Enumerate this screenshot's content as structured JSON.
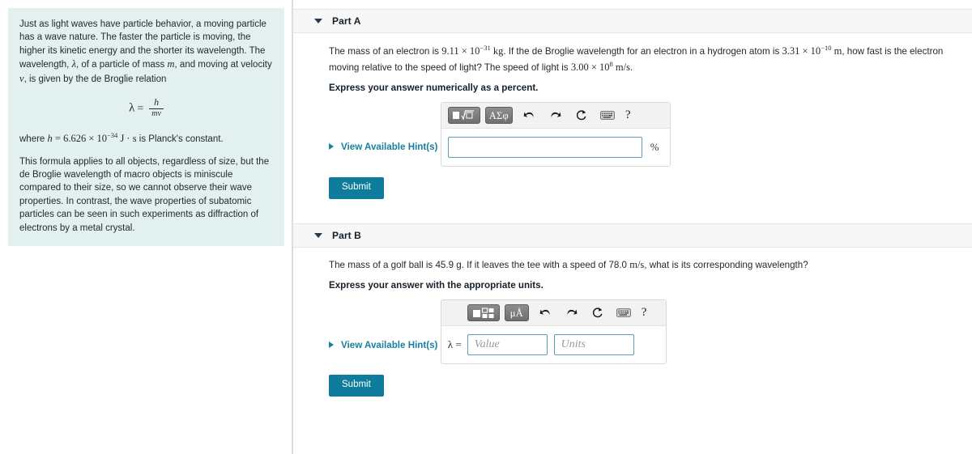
{
  "intro": {
    "paragraph1_a": "Just as light waves have particle behavior, a moving particle has a wave nature. The faster the particle is moving, the higher its kinetic energy and the shorter its wavelength. The wavelength, ",
    "lambda_sym": "λ",
    "paragraph1_b": ", of a particle of mass ",
    "m_sym": "m",
    "paragraph1_c": ", and moving at velocity ",
    "v_sym": "v",
    "paragraph1_d": ", is given by the de Broglie relation",
    "formula": {
      "lhs": "λ",
      "equals": "=",
      "numerator": "h",
      "denominator": "mv"
    },
    "where_prefix": "where ",
    "h_sym": "h",
    "h_equals": " = 6.626 × 10",
    "h_exp": "−34",
    "h_units": " J · s",
    "where_suffix": " is Planck's constant.",
    "paragraph3": "This formula applies to all objects, regardless of size, but the de Broglie wavelength of macro objects is miniscule compared to their size, so we cannot observe their wave properties. In contrast, the wave properties of subatomic particles can be seen in such experiments as diffraction of electrons by a metal crystal."
  },
  "partA": {
    "title": "Part A",
    "question_p1": "The mass of an electron is ",
    "mass_val": "9.11 × 10",
    "mass_exp": "−31",
    "mass_unit": " kg",
    "question_p2": ". If the de Broglie wavelength for an electron in a hydrogen atom is ",
    "wave_val": "3.31 × 10",
    "wave_exp": "−10",
    "wave_unit": " m",
    "question_p3": ", how fast is the electron moving relative to the speed of light? The speed of light is ",
    "c_val": "3.00 × 10",
    "c_exp": "8",
    "c_unit": " m/s",
    "question_p4": ".",
    "express": "Express your answer numerically as a percent.",
    "hint_link": "View Available Hint(s)",
    "toolbar": {
      "template_button": "math-template",
      "greek_button": "ΑΣφ",
      "undo": "undo-arrow",
      "redo": "redo-arrow",
      "reset": "reset-circle",
      "keyboard": "keyboard",
      "help": "?"
    },
    "answer_placeholder": "",
    "answer_value": "",
    "unit_suffix": "%",
    "submit_label": "Submit"
  },
  "partB": {
    "title": "Part B",
    "question_p1": "The mass of a golf ball is 45.9 g",
    "question_p2": ". If it leaves the tee with a speed of 78.0 ",
    "speed_unit": "m/s",
    "question_p3": ", what is its corresponding wavelength?",
    "express": "Express your answer with the appropriate units.",
    "hint_link": "View Available Hint(s)",
    "toolbar": {
      "template_button": "units-template",
      "units_button": "μÅ",
      "undo": "undo-arrow",
      "redo": "redo-arrow",
      "reset": "reset-circle",
      "keyboard": "keyboard",
      "help": "?"
    },
    "lambda_label": "λ =",
    "value_placeholder": "Value",
    "units_placeholder": "Units",
    "value_value": "",
    "units_value": "",
    "submit_label": "Submit"
  },
  "colors": {
    "accent_teal": "#0f7c9c",
    "link_teal": "#17819e",
    "intro_bg": "#e2f0f0",
    "header_bg": "#f7f7f7",
    "input_border": "#5a9fb5"
  }
}
